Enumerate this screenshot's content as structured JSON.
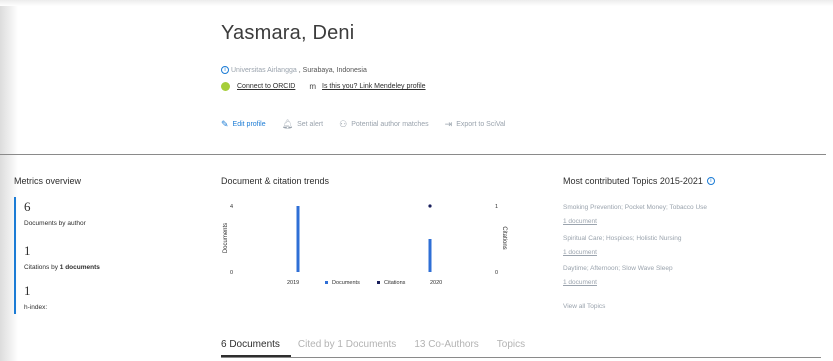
{
  "author": {
    "name": "Yasmara, Deni",
    "affiliation_link": "Universitas Airlangga",
    "location": ", Surabaya, Indonesia",
    "orcid_label": "Connect to ORCID",
    "mendeley_label": "Is this you? Link Mendeley profile"
  },
  "actions": {
    "edit_profile": "Edit profile",
    "set_alert": "Set alert",
    "potential_matches": "Potential author matches",
    "export_scival": "Export to SciVal"
  },
  "metrics": {
    "title": "Metrics overview",
    "documents_value": "6",
    "documents_label": "Documents by author",
    "citations_value": "1",
    "citations_label_prefix": "Citations by ",
    "citations_label_bold": "1 documents",
    "hindex_value": "1",
    "hindex_label": "h-index:"
  },
  "trends": {
    "title": "Document & citation trends"
  },
  "chart_data": {
    "type": "bar",
    "categories": [
      "2019",
      "2020"
    ],
    "series": [
      {
        "name": "Documents",
        "type": "bar",
        "values": [
          4,
          2
        ],
        "color": "#2f6fd6"
      },
      {
        "name": "Citations",
        "type": "scatter",
        "values": [
          0,
          1
        ],
        "color": "#1a1f5c"
      }
    ],
    "ylabel": "Documents",
    "ylabel_right": "Citations",
    "ylim": [
      0,
      4
    ],
    "ylim_right": [
      0,
      1
    ],
    "y_ticks": [
      "4",
      "0"
    ],
    "y_ticks_right": [
      "1",
      "0"
    ],
    "legend_placement": "bottom"
  },
  "topics": {
    "title": "Most contributed Topics 2015-2021",
    "items": [
      {
        "name": "Smoking Prevention; Pocket Money; Tobacco Use",
        "count": "1 document"
      },
      {
        "name": "Spiritual Care; Hospices; Holistic Nursing",
        "count": "1 document"
      },
      {
        "name": "Daytime; Afternoon; Slow Wave Sleep",
        "count": "1 document"
      }
    ],
    "view_all": "View all Topics"
  },
  "tabs": [
    {
      "label": "6 Documents",
      "active": true
    },
    {
      "label": "Cited by 1 Documents",
      "active": false
    },
    {
      "label": "13 Co-Authors",
      "active": false
    },
    {
      "label": "Topics",
      "active": false
    }
  ],
  "icons": {
    "info": "info-icon",
    "orcid": "orcid-icon",
    "mendeley": "mendeley-icon",
    "edit": "pencil-icon",
    "alert": "bell-icon",
    "matches": "people-icon",
    "export": "export-icon"
  },
  "colors": {
    "accent": "#1c7cd5",
    "orcid_green": "#a6ce39",
    "documents_bar": "#2f6fd6",
    "citations_point": "#1a1f5c"
  }
}
